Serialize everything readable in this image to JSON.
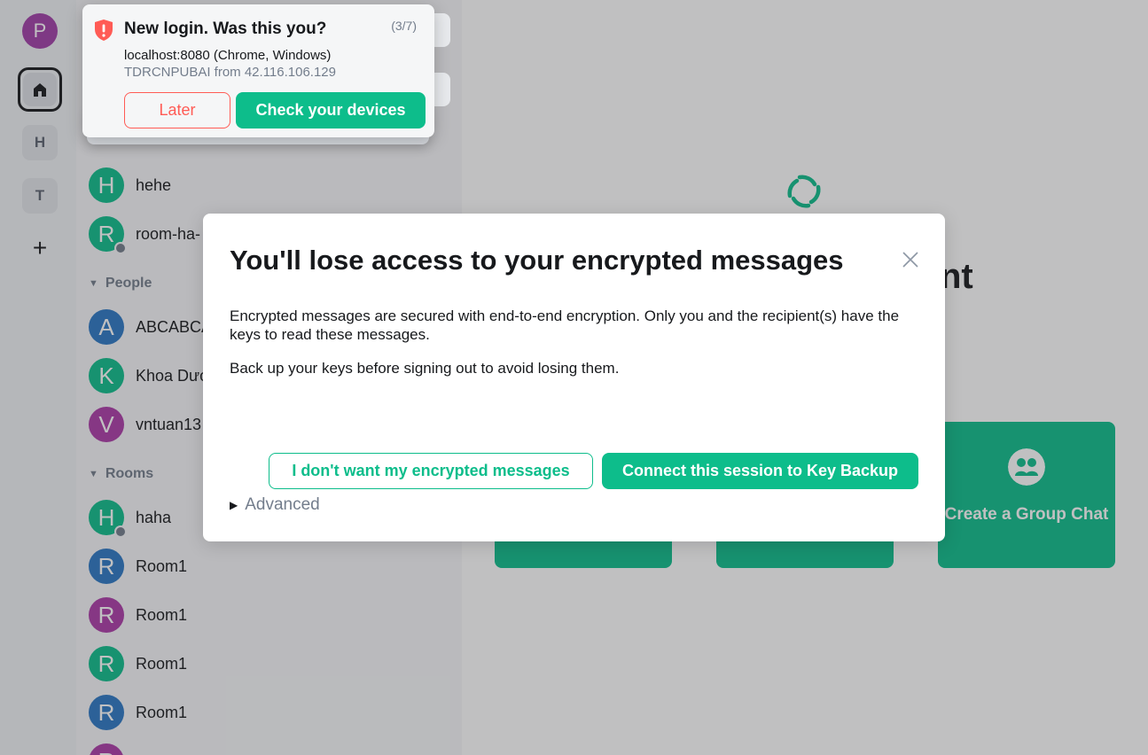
{
  "spaces": {
    "user_avatar_letter": "P",
    "items": [
      {
        "letter": "H"
      },
      {
        "letter": "T"
      }
    ],
    "add_symbol": "+"
  },
  "room_list": {
    "favourites": [
      {
        "letter": "H",
        "name": "hehe"
      },
      {
        "letter": "R",
        "name": "room-ha-"
      }
    ],
    "people_header": "People",
    "people": [
      {
        "letter": "A",
        "name": "ABCABCA"
      },
      {
        "letter": "K",
        "name": "Khoa Dươ"
      },
      {
        "letter": "V",
        "name": "vntuan13"
      }
    ],
    "rooms_header": "Rooms",
    "rooms": [
      {
        "letter": "H",
        "name": "haha"
      },
      {
        "letter": "R",
        "name": "Room1"
      },
      {
        "letter": "R",
        "name": "Room1"
      },
      {
        "letter": "R",
        "name": "Room1"
      },
      {
        "letter": "R",
        "name": "Room1"
      },
      {
        "letter": "R",
        "name": ""
      }
    ]
  },
  "home": {
    "welcome_fragment": "nt",
    "tiles": [
      {
        "label": ""
      },
      {
        "label": ""
      },
      {
        "label": "Create a Group Chat"
      }
    ]
  },
  "toast": {
    "title": "New login. Was this you?",
    "counter": "(3/7)",
    "device_line": "localhost:8080 (Chrome, Windows)",
    "ip_line": "TDRCNPUBAI from 42.116.106.129",
    "later_label": "Later",
    "check_label": "Check your devices"
  },
  "dialog": {
    "title": "You'll lose access to your encrypted messages",
    "paragraph1": "Encrypted messages are secured with end-to-end encryption. Only you and the recipient(s) have the keys to read these messages.",
    "paragraph2": "Back up your keys before signing out to avoid losing them.",
    "decline_label": "I don't want my encrypted messages",
    "confirm_label": "Connect this session to Key Backup",
    "advanced_label": "Advanced"
  },
  "colors": {
    "accent": "#0dbd8b",
    "alert": "#ff5b55",
    "secondary_text": "#737d8c",
    "avatar_blue": "#2b78c5",
    "avatar_purple": "#ac3ba8"
  }
}
